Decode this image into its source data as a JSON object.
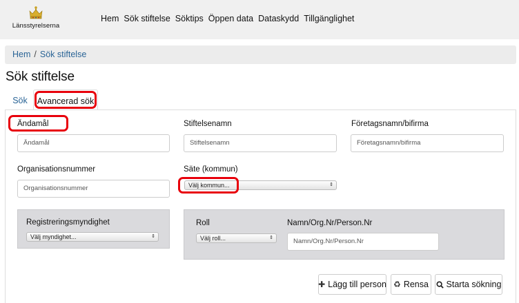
{
  "header": {
    "logo_text": "Länsstyrelserna",
    "nav": [
      "Hem",
      "Sök stiftelse",
      "Söktips",
      "Öppen data",
      "Dataskydd",
      "Tillgänglighet"
    ]
  },
  "breadcrumb": {
    "home": "Hem",
    "separator": "/",
    "current": "Sök stiftelse"
  },
  "page_title": "Sök stiftelse",
  "tabs": {
    "basic": "Sök",
    "advanced": "Avancerad sök"
  },
  "form": {
    "purpose": {
      "label": "Ändamål",
      "placeholder": "Ändamål"
    },
    "foundation_name": {
      "label": "Stiftelsenamn",
      "placeholder": "Stiftelsenamn"
    },
    "company_name": {
      "label": "Företagsnamn/bifirma",
      "placeholder": "Företagsnamn/bifirma"
    },
    "org_number": {
      "label": "Organisationsnummer",
      "placeholder": "Organisationsnummer"
    },
    "seat": {
      "label": "Säte (kommun)",
      "selected": "Välj kommun..."
    },
    "authority": {
      "label": "Registreringsmyndighet",
      "selected": "Välj myndighet..."
    },
    "role": {
      "label": "Roll",
      "selected": "Välj roll..."
    },
    "person": {
      "label": "Namn/Org.Nr/Person.Nr",
      "placeholder": "Namn/Org.Nr/Person.Nr"
    }
  },
  "buttons": {
    "add_person": "Lägg till person",
    "clear": "Rensa",
    "search": "Starta sökning"
  },
  "colors": {
    "link": "#2a6496",
    "highlight": "#e8000b",
    "gray_box": "#dadadd"
  },
  "icons": {
    "crown": "crown-icon",
    "plus": "plus-icon",
    "recycle": "recycle-icon",
    "search": "search-icon",
    "select_arrows": "updown-arrows-icon"
  }
}
